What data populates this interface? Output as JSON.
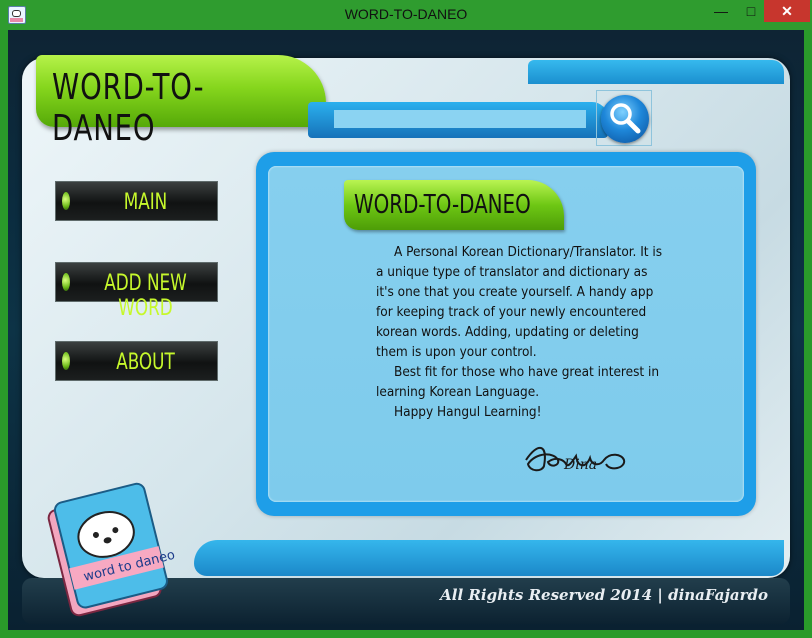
{
  "window": {
    "title": "WORD-TO-DANEO",
    "minimize_glyph": "—",
    "maximize_glyph": "□",
    "close_glyph": "✕"
  },
  "header": {
    "brand": "WORD-TO-DANEO",
    "search": {
      "value": "",
      "placeholder": ""
    }
  },
  "sidebar": {
    "items": [
      {
        "label": "MAIN"
      },
      {
        "label": "ADD NEW WORD"
      },
      {
        "label": "ABOUT"
      }
    ]
  },
  "content": {
    "title": "WORD-TO-DANEO",
    "paragraphs": [
      "A Personal Korean Dictionary/Translator. It is a unique type of translator and dictionary as it's one that you create yourself. A handy app for keeping track of your newly encountered korean words. Adding, updating or deleting them is upon your control.",
      "Best fit for those who have great interest in learning Korean Language.",
      "Happy Hangul Learning!"
    ],
    "signature": "Dina"
  },
  "book_cover": {
    "text": "word to daneo"
  },
  "footer": {
    "text": "All Rights Reserved 2014 | dinaFajardo"
  },
  "colors": {
    "title_bar": "#2f9c2f",
    "accent_green": "#86d61d",
    "accent_blue": "#1e9ee8",
    "nav_text": "#c6f82c",
    "close_button": "#c7362d"
  },
  "icons": [
    "app-icon",
    "search-icon",
    "minimize-icon",
    "maximize-icon",
    "close-icon",
    "book-logo-icon",
    "signature-icon"
  ]
}
